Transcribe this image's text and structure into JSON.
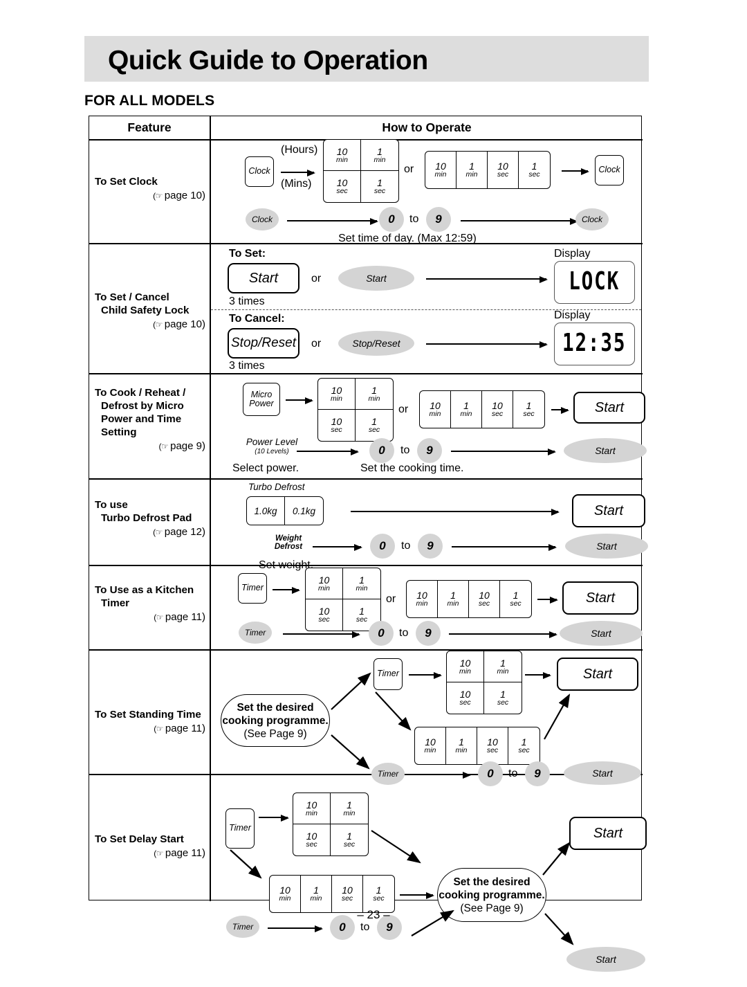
{
  "page": {
    "title": "Quick Guide to Operation",
    "subtitle": "FOR ALL MODELS",
    "footer": "– 23 –"
  },
  "table": {
    "headers": {
      "feature": "Feature",
      "how": "How to Operate"
    }
  },
  "common": {
    "or": "or",
    "to": "to",
    "zero": "0",
    "nine": "9",
    "start": "Start",
    "timer": "Timer",
    "clock": "Clock",
    "display": "Display",
    "pad_10min_v": "10",
    "pad_10min_u": "min",
    "pad_1min_v": "1",
    "pad_1min_u": "min",
    "pad_10sec_v": "10",
    "pad_10sec_u": "sec",
    "pad_1sec_v": "1",
    "pad_1sec_u": "sec",
    "hand_icon": "pointing-hand-icon"
  },
  "rows": [
    {
      "id": "set-clock",
      "feature_l1": "To Set Clock",
      "feature_l2": "",
      "page_ref": "page 10",
      "labels": {
        "hours": "(Hours)",
        "mins": "(Mins)",
        "caption": "Set time of day. (Max 12:59)"
      }
    },
    {
      "id": "child-safety-lock",
      "feature_l1": "To Set / Cancel",
      "feature_l2": "Child Safety Lock",
      "page_ref": "page 10",
      "labels": {
        "to_set": "To Set:",
        "to_cancel": "To Cancel:",
        "times": "3 times",
        "start_key": "Start",
        "stop_key": "Stop/Reset",
        "display": "Display",
        "lcd_lock": "LOCK",
        "lcd_time": "12:35"
      }
    },
    {
      "id": "cook-reheat-defrost",
      "feature_l1": "To Cook / Reheat /",
      "feature_l2": "Defrost by Micro",
      "feature_l3": "Power and Time",
      "feature_l4": "Setting",
      "page_ref": "page 9",
      "labels": {
        "micro": "Micro",
        "power": "Power",
        "power_level": "Power Level",
        "power_level_sub": "(10 Levels)",
        "select_power": "Select power.",
        "set_cooking_time": "Set the cooking time."
      }
    },
    {
      "id": "turbo-defrost",
      "feature_l1": "To use",
      "feature_l2": "Turbo Defrost Pad",
      "page_ref": "page 12",
      "labels": {
        "turbo_defrost": "Turbo Defrost",
        "kg_1": "1.0kg",
        "kg_01": "0.1kg",
        "weight": "Weight",
        "defrost": "Defrost",
        "set_weight": "Set weight."
      }
    },
    {
      "id": "kitchen-timer",
      "feature_l1": "To Use as a Kitchen",
      "feature_l2": "Timer",
      "page_ref": "page 11",
      "labels": {}
    },
    {
      "id": "standing-time",
      "feature_l1": "To Set Standing Time",
      "feature_l2": "",
      "page_ref": "page 11",
      "labels": {
        "prog_l1": "Set the desired",
        "prog_l2": "cooking programme.",
        "prog_l3": "(See Page 9)"
      }
    },
    {
      "id": "delay-start",
      "feature_l1": "To Set Delay Start",
      "feature_l2": "",
      "page_ref": "page 11",
      "labels": {
        "prog_l1": "Set the desired",
        "prog_l2": "cooking programme.",
        "prog_l3": "(See Page 9)"
      }
    }
  ]
}
